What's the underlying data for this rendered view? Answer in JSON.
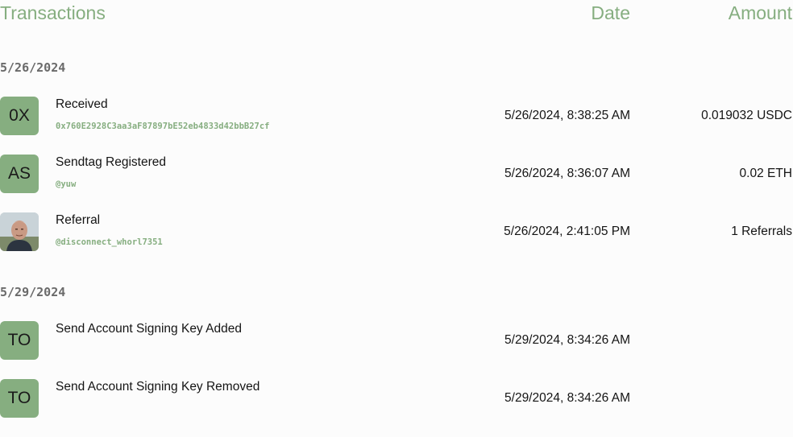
{
  "header": {
    "title": "Transactions",
    "date_label": "Date",
    "amount_label": "Amount"
  },
  "colors": {
    "accent": "#86AE80",
    "avatar_bg": "#86AE80",
    "group_date": "#6a6a6a",
    "text": "#141414",
    "background": "#fcfcfc"
  },
  "groups": [
    {
      "date": "5/26/2024",
      "items": [
        {
          "avatar": "0X",
          "title": "Received",
          "subtitle": "0x760E2928C3aa3aF87897bE52eb4833d42bbB27cf",
          "datetime": "5/26/2024, 8:38:25 AM",
          "amount": "0.019032 USDC"
        },
        {
          "avatar": "AS",
          "title": "Sendtag Registered",
          "subtitle": "@yuw",
          "datetime": "5/26/2024, 8:36:07 AM",
          "amount": "0.02 ETH"
        },
        {
          "avatar": "",
          "avatar_icon": "user-photo-icon",
          "title": "Referral",
          "subtitle": "@disconnect_whorl7351",
          "datetime": "5/26/2024, 2:41:05 PM",
          "amount": "1 Referrals"
        }
      ]
    },
    {
      "date": "5/29/2024",
      "items": [
        {
          "avatar": "TO",
          "title": "Send Account Signing Key Added",
          "subtitle": "",
          "datetime": "5/29/2024, 8:34:26 AM",
          "amount": ""
        },
        {
          "avatar": "TO",
          "title": "Send Account Signing Key Removed",
          "subtitle": "",
          "datetime": "5/29/2024, 8:34:26 AM",
          "amount": ""
        }
      ]
    }
  ]
}
